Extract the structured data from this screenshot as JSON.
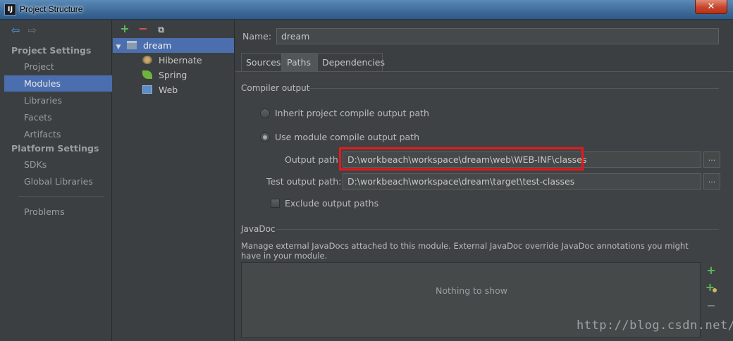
{
  "window": {
    "title": "Project Structure",
    "close_label": "✕"
  },
  "nav": {
    "project_settings_heading": "Project Settings",
    "project_settings_items": [
      "Project",
      "Modules",
      "Libraries",
      "Facets",
      "Artifacts"
    ],
    "platform_settings_heading": "Platform Settings",
    "platform_settings_items": [
      "SDKs",
      "Global Libraries"
    ],
    "problems": "Problems",
    "selected": "Modules"
  },
  "tree": {
    "toolbar": {
      "add": "+",
      "remove": "−",
      "copy": "⧉"
    },
    "root": "dream",
    "children": [
      "Hibernate",
      "Spring",
      "Web"
    ]
  },
  "module": {
    "name_label": "Name:",
    "name_value": "dream",
    "tabs": [
      "Sources",
      "Paths",
      "Dependencies"
    ],
    "active_tab": "Paths"
  },
  "compiler_output": {
    "heading": "Compiler output",
    "inherit_label": "Inherit project compile output path",
    "use_module_label": "Use module compile output path",
    "output_path_label": "Output path:",
    "output_path_value": "D:\\workbeach\\workspace\\dream\\web\\WEB-INF\\classes",
    "test_output_path_label": "Test output path:",
    "test_output_path_value": "D:\\workbeach\\workspace\\dream\\target\\test-classes",
    "browse_label": "...",
    "exclude_label": "Exclude output paths"
  },
  "javadoc": {
    "heading": "JavaDoc",
    "description": "Manage external JavaDocs attached to this module. External JavaDoc override JavaDoc annotations you might have in your module.",
    "empty_text": "Nothing to show",
    "buttons": {
      "add": "+",
      "add_url": "+",
      "remove": "−"
    }
  },
  "watermark": "http://blog.csdn.net/",
  "colors": {
    "selection": "#4b6eaf",
    "highlight_box": "#e8171c",
    "background": "#3c3f41"
  }
}
